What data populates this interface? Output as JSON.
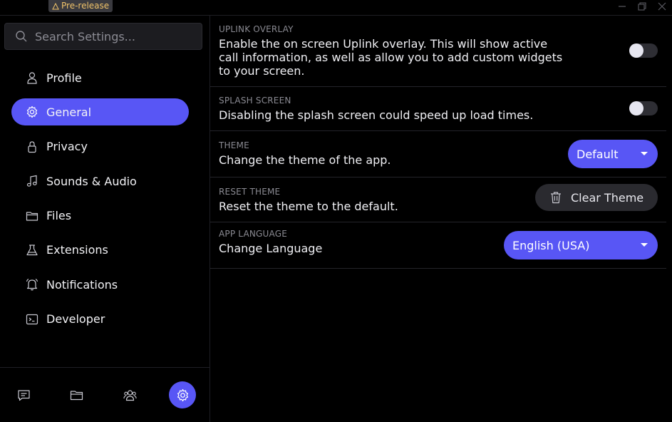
{
  "titlebar": {
    "badge": "Pre-release"
  },
  "search": {
    "placeholder": "Search Settings..."
  },
  "sidebar": {
    "items": [
      {
        "label": "Profile",
        "icon": "user-icon",
        "active": false
      },
      {
        "label": "General",
        "icon": "gear-icon",
        "active": true
      },
      {
        "label": "Privacy",
        "icon": "lock-icon",
        "active": false
      },
      {
        "label": "Sounds & Audio",
        "icon": "music-note-icon",
        "active": false
      },
      {
        "label": "Files",
        "icon": "folder-icon",
        "active": false
      },
      {
        "label": "Extensions",
        "icon": "beaker-icon",
        "active": false
      },
      {
        "label": "Notifications",
        "icon": "bell-icon",
        "active": false
      },
      {
        "label": "Developer",
        "icon": "terminal-icon",
        "active": false
      }
    ]
  },
  "bottombar": {
    "items": [
      {
        "icon": "chat-icon",
        "active": false
      },
      {
        "icon": "folder-icon",
        "active": false
      },
      {
        "icon": "users-icon",
        "active": false
      },
      {
        "icon": "gear-icon",
        "active": true
      }
    ]
  },
  "settings": {
    "uplink_overlay": {
      "label": "UPLINK OVERLAY",
      "description": "Enable the on screen Uplink overlay. This will show active call information, as well as allow you to add custom widgets to your screen.",
      "enabled": false
    },
    "splash_screen": {
      "label": "SPLASH SCREEN",
      "description": "Disabling the splash screen could speed up load times.",
      "enabled": false
    },
    "theme": {
      "label": "THEME",
      "description": "Change the theme of the app.",
      "value": "Default"
    },
    "reset_theme": {
      "label": "RESET THEME",
      "description": "Reset the theme to the default.",
      "button": "Clear Theme"
    },
    "app_language": {
      "label": "APP LANGUAGE",
      "description": "Change Language",
      "value": "English (USA)"
    }
  },
  "colors": {
    "accent": "#5856f5",
    "background": "#000000",
    "badge_text": "#f0c36a"
  }
}
